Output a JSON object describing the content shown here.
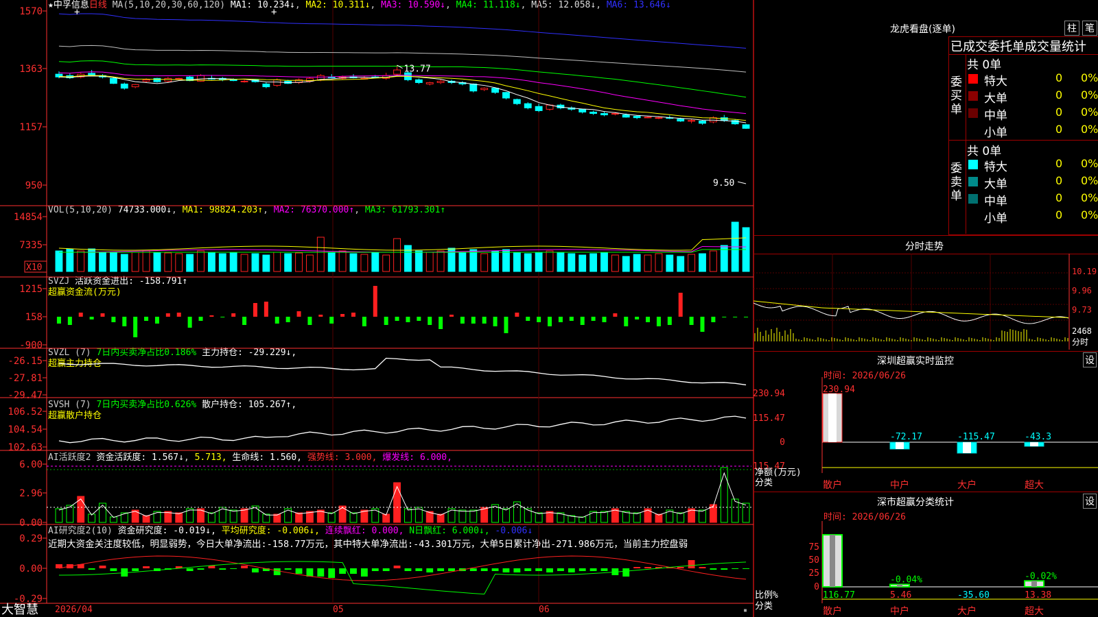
{
  "brand": "大智慧",
  "colors": {
    "up": "#ff2020",
    "down": "#00ffff",
    "grid": "#8b0000",
    "axis": "#ff3030",
    "white": "#ffffff",
    "yellow": "#ffff00",
    "magenta": "#ff00ff",
    "green": "#00ff00",
    "blue": "#3030ff",
    "gray": "#c0c0c0"
  },
  "main": {
    "star": "★",
    "stock": "中孚信息",
    "period": "日线",
    "ma_label": "MA(5,10,20,30,60,120)",
    "ma": [
      {
        "name": "MA1:",
        "value": "10.234↓"
      },
      {
        "name": "MA2:",
        "value": "10.311↓"
      },
      {
        "name": "MA3:",
        "value": "10.590↓"
      },
      {
        "name": "MA4:",
        "value": "11.118↓"
      },
      {
        "name": "MA5:",
        "value": "12.058↓"
      },
      {
        "name": "MA6:",
        "value": "13.646↓"
      }
    ],
    "y_ticks": [
      "1570",
      "1363",
      "1157",
      "950"
    ],
    "high_label": "13.77",
    "low_label": "9.50"
  },
  "vol": {
    "label": "VOL(5,10,20)",
    "value": "74733.000↓",
    "ma": [
      {
        "name": "MA1:",
        "value": "98824.203↑"
      },
      {
        "name": "MA2:",
        "value": "76370.000↑"
      },
      {
        "name": "MA3:",
        "value": "61793.301↑"
      }
    ],
    "y_ticks": [
      "14854",
      "7335"
    ],
    "unit": "X10"
  },
  "svzj": {
    "name": "SVZJ",
    "item": "活跃资金进出:",
    "value": "-158.791↑",
    "subtitle": "超赢资金流(万元)",
    "y_ticks": [
      "1215",
      "158",
      "-900"
    ]
  },
  "svzl": {
    "name": "SVZL (7)",
    "desc": "7日内买卖净占比0.186%",
    "item": "主力持仓:",
    "value": "-29.229↓,",
    "subtitle": "超赢主力持仓",
    "y_ticks": [
      "-26.15",
      "-27.81",
      "-29.47"
    ]
  },
  "svsh": {
    "name": "SVSH (7)",
    "desc": "7日内买卖净占比0.626%",
    "item": "散户持仓:",
    "value": "105.267↑,",
    "subtitle": "超赢散户持仓",
    "y_ticks": [
      "106.52",
      "104.54",
      "102.63"
    ]
  },
  "ai_active": {
    "name": "AI活跃度2",
    "item1": "资金活跃度:",
    "val1": "1.567↓",
    "val2": "5.713,",
    "item3": "生命线:",
    "val3": "1.560,",
    "strong": "强势线: 3.000,",
    "burst": "爆发线: 6.000,",
    "y_ticks": [
      "6.00",
      "2.96",
      "0.00"
    ]
  },
  "ai_research": {
    "name": "AI研究度2(10)",
    "item1": "资金研究度:",
    "val1": "-0.019↓,",
    "item2": "平均研究度:",
    "val2": "-0.006↓,",
    "item3": "连续飘红: 0.000,",
    "item4": "N日飘红: 6.000↓,",
    "item5": "-0.006↓",
    "comment": "近期大资金关注度较低，明显弱势，今日大单净流出:-158.77万元，其中特大单净流出:-43.301万元，大单5日累计净出-271.986万元，当前主力控盘弱",
    "y_ticks": [
      "0.29",
      "0.00",
      "-0.29"
    ]
  },
  "x_axis": {
    "labels": [
      "2026/04",
      "05",
      "06"
    ]
  },
  "right": {
    "lh_title": "龙虎看盘(逐单)",
    "lh_btn1": "柱",
    "lh_btn2": "笔",
    "stat_title": "已成交委托单成交量统计",
    "buy_label": "委买单",
    "sell_label": "委卖单",
    "buy_total": "共 0单",
    "sell_total": "共 0单",
    "buy_rows": [
      {
        "name": "特大",
        "count": "0",
        "pct": "0%"
      },
      {
        "name": "大单",
        "count": "0",
        "pct": "0%"
      },
      {
        "name": "中单",
        "count": "0",
        "pct": "0%"
      },
      {
        "name": "小单",
        "count": "0",
        "pct": "0%"
      }
    ],
    "sell_rows": [
      {
        "name": "特大",
        "count": "0",
        "pct": "0%"
      },
      {
        "name": "大单",
        "count": "0",
        "pct": "0%"
      },
      {
        "name": "中单",
        "count": "0",
        "pct": "0%"
      },
      {
        "name": "小单",
        "count": "0",
        "pct": "0%"
      }
    ],
    "fs_title": "分时走势",
    "fs_ticks": [
      "10.19",
      "9.96",
      "9.73"
    ],
    "fs_vol_tick": "2468",
    "fs_unit": "分时",
    "sz_title": "深圳超赢实时监控",
    "sz_btn": "设",
    "sz_time": "时间: 2026/06/26",
    "sz_yticks": [
      "230.94",
      "115.47",
      "0",
      "-115.47"
    ],
    "sz_ylabel": "净额(万元)",
    "sz_xlabel": "分类",
    "sz_bars": [
      {
        "cat": "散户",
        "value": 230.94,
        "label": "230.94"
      },
      {
        "cat": "中户",
        "value": -72.17,
        "label": "-72.17"
      },
      {
        "cat": "大户",
        "value": -115.47,
        "label": "-115.47"
      },
      {
        "cat": "超大",
        "value": -43.3,
        "label": "-43.3"
      }
    ],
    "cls_title": "深市超赢分类统计",
    "cls_btn": "设",
    "cls_time": "时间: 2026/06/26",
    "cls_yticks": [
      "75",
      "50",
      "25",
      "0"
    ],
    "cls_ylabel": "比例%",
    "cls_xlabel": "分类",
    "cls_bars": [
      {
        "cat": "散户",
        "value": 116.77,
        "label": "116.77",
        "top": ""
      },
      {
        "cat": "中户",
        "value": 5.46,
        "label": "5.46",
        "top": "-0.04%"
      },
      {
        "cat": "大户",
        "value": -35.6,
        "label": "-35.60",
        "top": ""
      },
      {
        "cat": "超大",
        "value": 13.38,
        "label": "13.38",
        "top": "-0.02%"
      }
    ]
  },
  "chart_data": {
    "type": "candlestick",
    "title": "中孚信息 日线",
    "candles": [
      [
        13.45,
        13.55,
        13.3,
        13.35
      ],
      [
        13.4,
        13.48,
        13.28,
        13.32
      ],
      [
        13.35,
        13.5,
        13.3,
        13.45
      ],
      [
        13.48,
        13.6,
        13.38,
        13.42
      ],
      [
        13.4,
        13.45,
        13.3,
        13.35
      ],
      [
        13.3,
        13.35,
        13.1,
        13.12
      ],
      [
        13.1,
        13.15,
        12.9,
        12.95
      ],
      [
        13.0,
        13.1,
        12.95,
        13.08
      ],
      [
        13.2,
        13.3,
        13.15,
        13.25
      ],
      [
        13.3,
        13.32,
        13.15,
        13.18
      ],
      [
        13.2,
        13.35,
        13.15,
        13.3
      ],
      [
        13.3,
        13.32,
        13.28,
        13.3
      ],
      [
        13.35,
        13.4,
        13.2,
        13.22
      ],
      [
        13.2,
        13.45,
        13.18,
        13.4
      ],
      [
        13.3,
        13.42,
        13.25,
        13.28
      ],
      [
        13.3,
        13.35,
        13.2,
        13.25
      ],
      [
        13.25,
        13.3,
        13.2,
        13.22
      ],
      [
        13.2,
        13.25,
        13.15,
        13.2
      ],
      [
        13.25,
        13.28,
        13.15,
        13.18
      ],
      [
        13.1,
        13.15,
        12.95,
        13.0
      ],
      [
        13.05,
        13.3,
        13.0,
        13.25
      ],
      [
        13.2,
        13.25,
        13.1,
        13.12
      ],
      [
        13.15,
        13.3,
        13.1,
        13.25
      ],
      [
        13.2,
        13.35,
        13.15,
        13.3
      ],
      [
        13.25,
        13.45,
        13.2,
        13.4
      ],
      [
        13.35,
        13.45,
        13.3,
        13.32
      ],
      [
        13.3,
        13.4,
        13.25,
        13.35
      ],
      [
        13.35,
        13.45,
        13.3,
        13.32
      ],
      [
        13.3,
        13.38,
        13.28,
        13.3
      ],
      [
        13.35,
        13.42,
        13.3,
        13.32
      ],
      [
        13.3,
        13.5,
        13.25,
        13.4
      ],
      [
        13.45,
        13.77,
        13.4,
        13.6
      ],
      [
        13.5,
        13.55,
        13.2,
        13.25
      ],
      [
        13.25,
        13.3,
        13.1,
        13.15
      ],
      [
        13.1,
        13.18,
        13.05,
        13.15
      ],
      [
        13.15,
        13.25,
        13.1,
        13.2
      ],
      [
        13.2,
        13.25,
        13.1,
        13.15
      ],
      [
        13.15,
        13.2,
        13.05,
        13.1
      ],
      [
        13.1,
        13.12,
        12.8,
        12.85
      ],
      [
        12.9,
        12.98,
        12.85,
        12.95
      ],
      [
        12.95,
        12.98,
        12.75,
        12.8
      ],
      [
        12.8,
        12.82,
        12.55,
        12.6
      ],
      [
        12.55,
        12.58,
        12.35,
        12.4
      ],
      [
        12.4,
        12.45,
        12.2,
        12.25
      ],
      [
        12.3,
        12.4,
        12.1,
        12.15
      ],
      [
        12.2,
        12.38,
        12.15,
        12.35
      ],
      [
        12.35,
        12.4,
        12.2,
        12.25
      ],
      [
        12.25,
        12.3,
        12.15,
        12.2
      ],
      [
        12.2,
        12.22,
        12.05,
        12.1
      ],
      [
        12.1,
        12.15,
        12.0,
        12.05
      ],
      [
        12.05,
        12.12,
        11.95,
        12.0
      ],
      [
        12.05,
        12.1,
        11.98,
        12.05
      ],
      [
        12.0,
        12.05,
        11.9,
        11.92
      ],
      [
        11.95,
        11.98,
        11.85,
        11.9
      ],
      [
        11.92,
        11.95,
        11.88,
        11.92
      ],
      [
        11.9,
        11.95,
        11.85,
        11.9
      ],
      [
        11.9,
        11.98,
        11.85,
        11.88
      ],
      [
        11.85,
        11.9,
        11.75,
        11.78
      ],
      [
        11.8,
        11.85,
        11.7,
        11.8
      ],
      [
        11.78,
        11.82,
        11.65,
        11.7
      ],
      [
        11.75,
        11.95,
        11.7,
        11.9
      ],
      [
        11.9,
        12.0,
        11.75,
        11.8
      ],
      [
        11.8,
        11.85,
        11.65,
        11.68
      ],
      [
        11.65,
        11.68,
        11.5,
        11.52
      ]
    ],
    "xlabel": "",
    "ylabel": ""
  }
}
